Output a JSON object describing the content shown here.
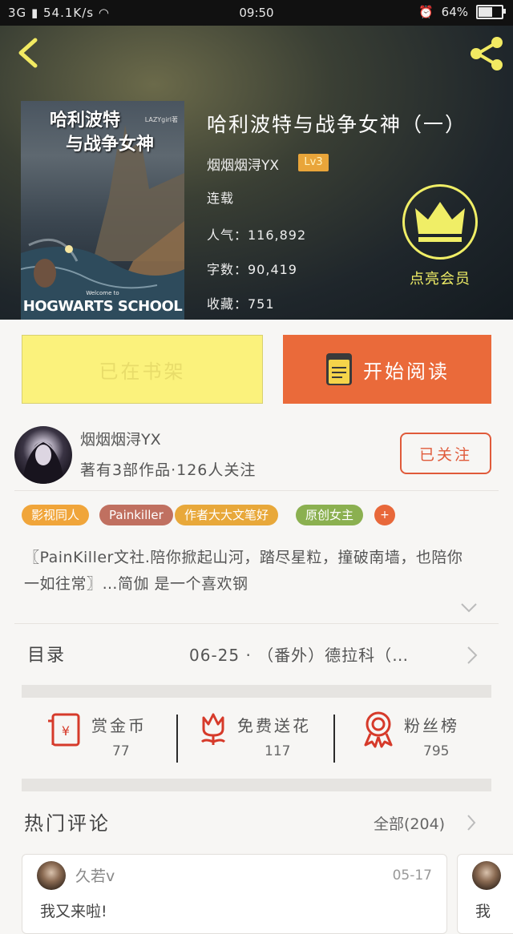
{
  "status_bar": {
    "network": "3G",
    "speed": "54.1K/s",
    "time": "09:50",
    "battery": "64%",
    "battery_level": 0.64
  },
  "book": {
    "title": "哈利波特与战争女神（一）",
    "author": "烟烟烟浔YX",
    "level": "Lv3",
    "status": "连载",
    "popularity": "人气：116,892",
    "word_count": "字数：90,419",
    "favorites": "收藏：751",
    "cover": {
      "title_line1": "哈利波特",
      "title_line2": "与战争女神",
      "author": "LAZYgirl著",
      "welcome": "Welcome to",
      "school": "HOGWARTS SCHOOL"
    },
    "vip_label": "点亮会员"
  },
  "actions": {
    "shelf_label": "已在书架",
    "read_label": "开始阅读"
  },
  "author_card": {
    "name": "烟烟烟浔YX",
    "info": "著有3部作品·126人关注",
    "follow_label": "已关注"
  },
  "tags": [
    {
      "label": "影视同人",
      "color": "#f0a53a"
    },
    {
      "label": "Painkiller",
      "color": "#c07060"
    },
    {
      "label": "作者大大文笔好",
      "color": "#e8a83a"
    },
    {
      "label": "原创女主",
      "color": "#8bb050"
    }
  ],
  "tag_more": "+",
  "description": "〖PainKiller文社.陪你掀起山河，踏尽星粒，撞破南墙，也陪你一如往常〗…简伽 是一个喜欢钢",
  "toc": {
    "label": "目录",
    "latest": "06-25 · （番外）德拉科（…"
  },
  "stats": [
    {
      "title": "赏金币",
      "count": "77",
      "icon": "red-envelope-icon"
    },
    {
      "title": "免费送花",
      "count": "117",
      "icon": "flower-icon"
    },
    {
      "title": "粉丝榜",
      "count": "795",
      "icon": "medal-icon"
    }
  ],
  "hot_comments": {
    "title": "热门评论",
    "all_label": "全部(204)",
    "comments": [
      {
        "name": "久若v",
        "date": "05-17",
        "text": "我又来啦!"
      },
      {
        "text": "我"
      }
    ]
  },
  "colors": {
    "accent_orange": "#ea6a3a",
    "shelf_yellow": "#fbf27c",
    "vip_yellow": "#f0ee66",
    "badge_orange": "#e9a53a",
    "icon_red": "#d63a2a"
  }
}
